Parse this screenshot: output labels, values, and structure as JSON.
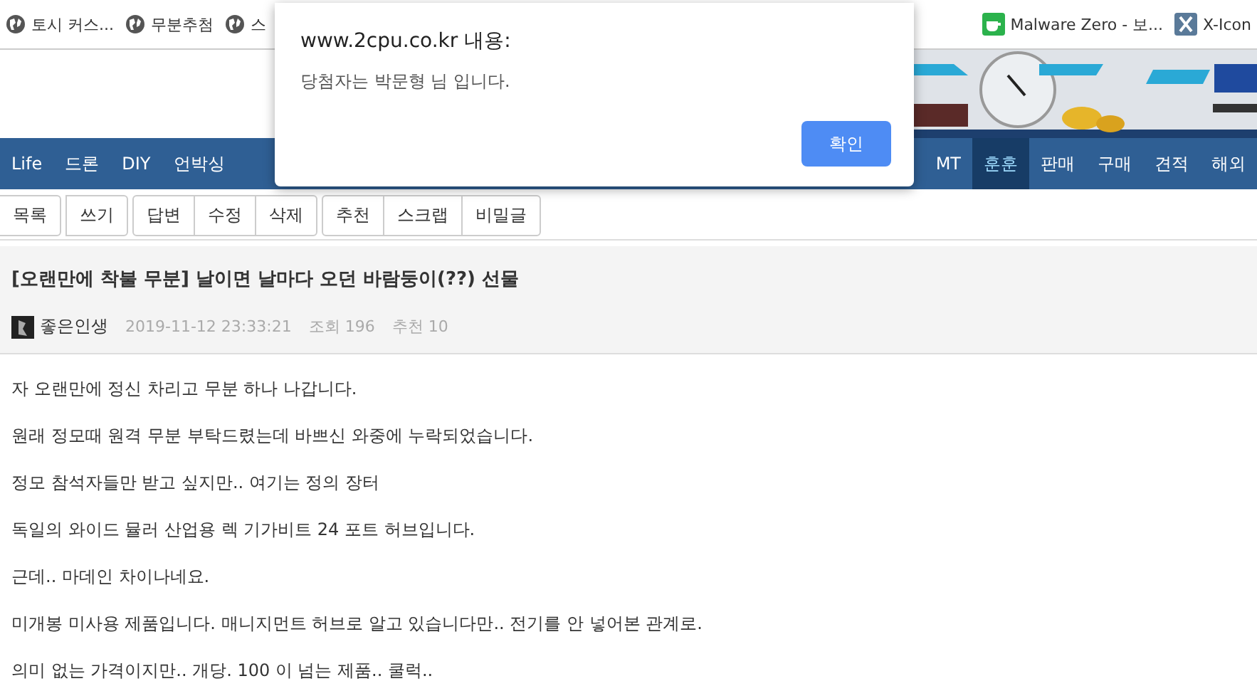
{
  "bookmarks": [
    {
      "kind": "globe",
      "label": "토시 커스..."
    },
    {
      "kind": "globe",
      "label": "무분추첨"
    },
    {
      "kind": "globe",
      "label": "스"
    },
    {
      "kind": "cup",
      "label": "Malware Zero - 보..."
    },
    {
      "kind": "xbox",
      "label": "X-Icon"
    }
  ],
  "banner": {
    "kind": "picture"
  },
  "nav": {
    "left": [
      {
        "label": "Life",
        "selected": false
      },
      {
        "label": "드론",
        "selected": false
      },
      {
        "label": "DIY",
        "selected": false
      },
      {
        "label": "언박싱",
        "selected": false
      }
    ],
    "right": [
      {
        "label": "MT",
        "selected": false
      },
      {
        "label": "훈훈",
        "selected": true
      },
      {
        "label": "판매",
        "selected": false
      },
      {
        "label": "구매",
        "selected": false
      },
      {
        "label": "견적",
        "selected": false
      },
      {
        "label": "해외",
        "selected": false
      }
    ]
  },
  "toolbar": [
    [
      "목록"
    ],
    [
      "쓰기"
    ],
    [
      "답변",
      "수정",
      "삭제"
    ],
    [
      "추천",
      "스크랩",
      "비밀글"
    ]
  ],
  "post": {
    "title": "[오랜만에 착불 무분] 날이면 날마다 오던 바람둥이(??) 선물",
    "author": "좋은인생",
    "date": "2019-11-12 23:33:21",
    "views": "조회 196",
    "recommend": "추천 10",
    "paragraphs": [
      "자 오랜만에 정신 차리고 무분 하나 나갑니다.",
      "원래 정모때 원격 무분 부탁드렸는데 바쁘신 와중에 누락되었습니다.",
      "정모 참석자들만 받고 싶지만.. 여기는 정의 장터",
      "독일의 와이드 뮬러 산업용 렉 기가비트 24 포트 허브입니다.",
      "근데.. 마데인 차이나네요.",
      "미개봉 미사용 제품입니다. 매니지먼트 허브로 알고 있습니다만.. 전기를 안 넣어본 관계로.",
      "의미 없는 가격이지만.. 개당. 100 이 넘는 제품.. 쿨럭.."
    ]
  },
  "dialog": {
    "title": "www.2cpu.co.kr 내용:",
    "message": "당첨자는 박문형 님 입니다.",
    "button": "확인"
  }
}
